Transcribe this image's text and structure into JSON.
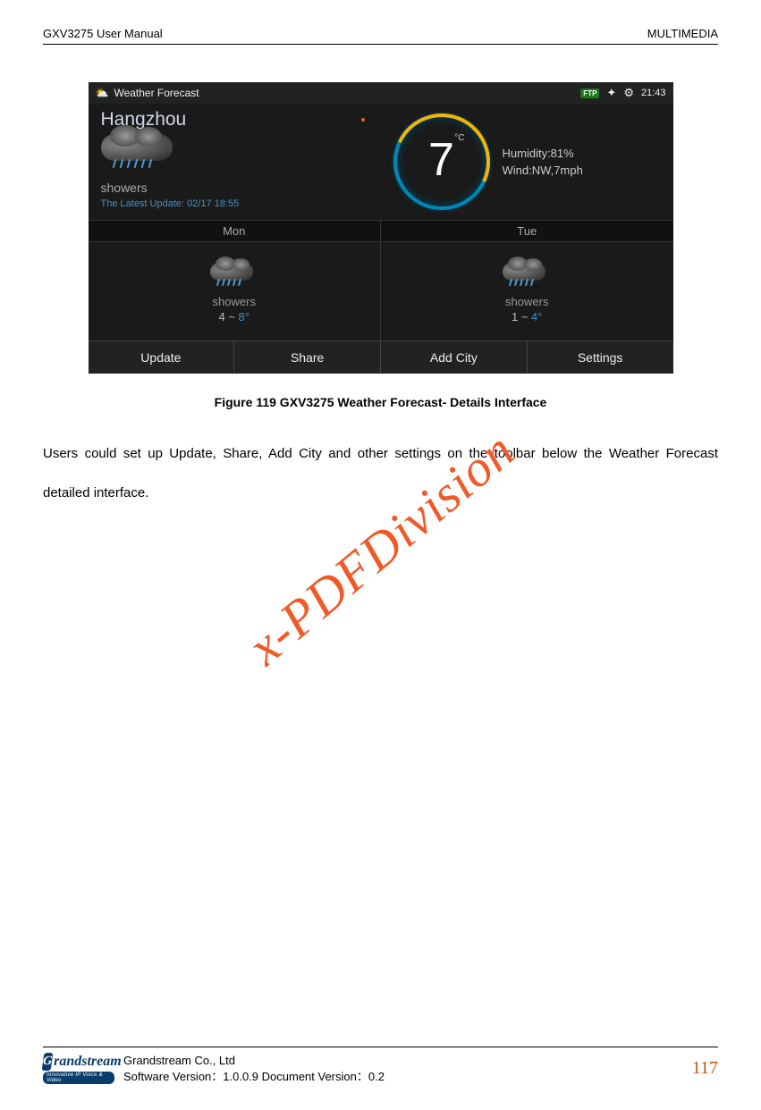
{
  "header": {
    "left": "GXV3275 User Manual",
    "right": "MULTIMEDIA"
  },
  "screenshot": {
    "titlebar": {
      "appName": "Weather Forecast",
      "ftpBadge": "FTP",
      "time": "21:43"
    },
    "main": {
      "city": "Hangzhou",
      "condition": "showers",
      "updateLabel": "The Latest Update:  02/17 18:55",
      "tempValue": "7",
      "tempUnit": "°C",
      "humidity": "Humidity:81%",
      "wind": "Wind:NW,7mph"
    },
    "forecastDays": {
      "day1": "Mon",
      "day2": "Tue"
    },
    "forecast": {
      "day1": {
        "cond": "showers",
        "low": "4 ~ ",
        "high": "8°"
      },
      "day2": {
        "cond": "showers",
        "low": "1 ~ ",
        "high": "4°"
      }
    },
    "toolbar": {
      "update": "Update",
      "share": "Share",
      "addCity": "Add City",
      "settings": "Settings"
    }
  },
  "figureCaption": "Figure 119 GXV3275 Weather Forecast- Details Interface",
  "bodyText": "Users could set up Update, Share, Add City and other settings on the toolbar below the Weather Forecast detailed interface.",
  "watermark": "x-PDFDivision",
  "footer": {
    "logoText": "randstream",
    "logoSub": "Innovative IP Voice & Video",
    "company": "Grandstream Co., Ltd",
    "version": "Software Version：1.0.0.9 Document Version：0.2",
    "pageNumber": "117"
  }
}
